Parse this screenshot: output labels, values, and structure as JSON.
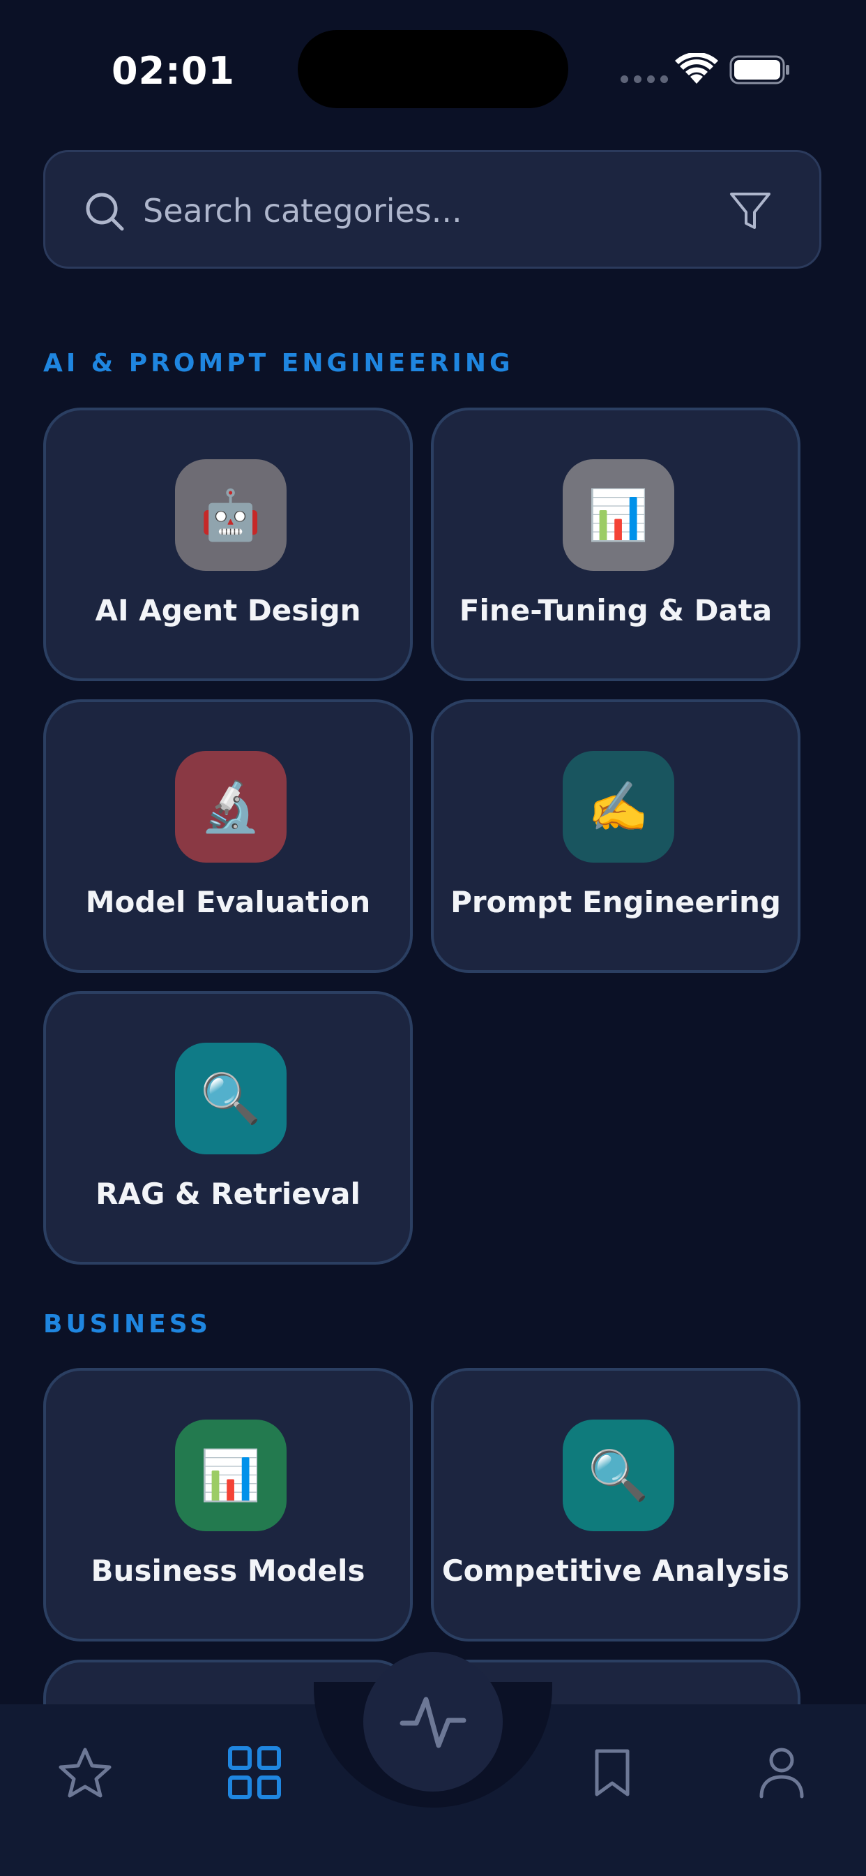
{
  "status_bar": {
    "time": "02:01"
  },
  "search": {
    "placeholder": "Search categories...",
    "value": ""
  },
  "sections": [
    {
      "title": "AI & PROMPT ENGINEERING",
      "items": [
        {
          "label": "AI Agent Design",
          "emoji": "🤖",
          "icon_color": "#6e6c74"
        },
        {
          "label": "Fine-Tuning & Data",
          "emoji": "📊",
          "icon_color": "#75757d"
        },
        {
          "label": "Model Evaluation",
          "emoji": "🔬",
          "icon_color": "#8a3944"
        },
        {
          "label": "Prompt Engineering",
          "emoji": "✍️",
          "icon_color": "#19555f"
        },
        {
          "label": "RAG & Retrieval",
          "emoji": "🔍",
          "icon_color": "#0f7b87"
        }
      ]
    },
    {
      "title": "BUSINESS",
      "items": [
        {
          "label": "Business Models",
          "emoji": "📊",
          "icon_color": "#237a4f"
        },
        {
          "label": "Competitive Analysis",
          "emoji": "🔍",
          "icon_color": "#0f7b7c"
        }
      ]
    }
  ],
  "nav": {
    "items": [
      "favorites",
      "categories",
      "activity",
      "bookmarks",
      "profile"
    ],
    "active": "categories",
    "accent_color": "#1f86e0",
    "inactive_color": "#6d7896"
  }
}
